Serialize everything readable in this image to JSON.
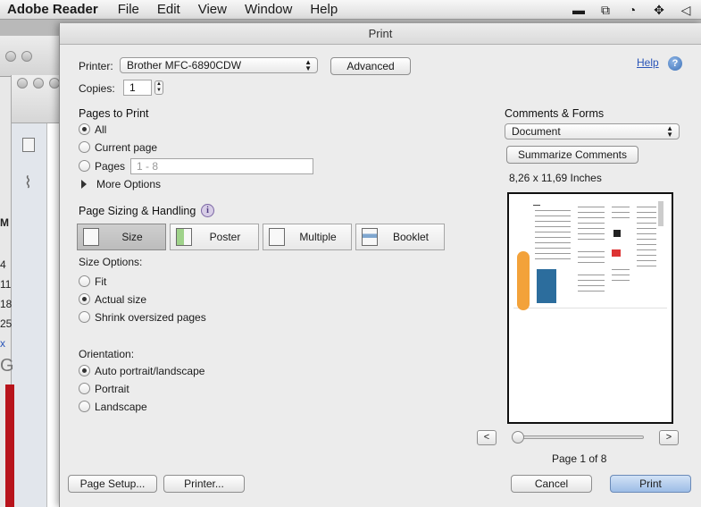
{
  "menubar": {
    "app": "Adobe Reader",
    "items": [
      "File",
      "Edit",
      "View",
      "Window",
      "Help"
    ]
  },
  "background": {
    "fragments": [
      "M",
      "4",
      "11",
      "18",
      "25",
      "x",
      "G"
    ]
  },
  "dialog": {
    "title": "Print",
    "printer_label": "Printer:",
    "printer_value": "Brother MFC-6890CDW",
    "advanced_label": "Advanced",
    "help_link": "Help",
    "help_icon": "?",
    "copies_label": "Copies:",
    "copies_value": "1",
    "pages_to_print": {
      "heading": "Pages to Print",
      "all": "All",
      "current_page": "Current page",
      "pages": "Pages",
      "pages_placeholder": "1 - 8",
      "more_options": "More Options",
      "selected": "all"
    },
    "page_sizing": {
      "heading": "Page Sizing & Handling",
      "info_icon": "i",
      "buttons": [
        "Size",
        "Poster",
        "Multiple",
        "Booklet"
      ],
      "selected": "Size"
    },
    "size_options": {
      "label": "Size Options:",
      "fit": "Fit",
      "actual_size": "Actual size",
      "shrink": "Shrink oversized pages",
      "selected": "actual_size"
    },
    "orientation": {
      "label": "Orientation:",
      "auto": "Auto portrait/landscape",
      "portrait": "Portrait",
      "landscape": "Landscape",
      "selected": "auto"
    },
    "comments_forms": {
      "heading": "Comments & Forms",
      "value": "Document",
      "summarize_label": "Summarize Comments"
    },
    "paper_size": "8,26 x 11,69 Inches",
    "preview": {
      "prev": "<",
      "next": ">",
      "page_status": "Page 1 of 8",
      "page_progress": 0.0
    },
    "footer": {
      "page_setup": "Page Setup...",
      "printer": "Printer...",
      "cancel": "Cancel",
      "print": "Print"
    }
  },
  "colors": {
    "accent_link": "#2a55b8",
    "default_button": "#9dbde6",
    "brand_orange": "#f3a23a"
  }
}
